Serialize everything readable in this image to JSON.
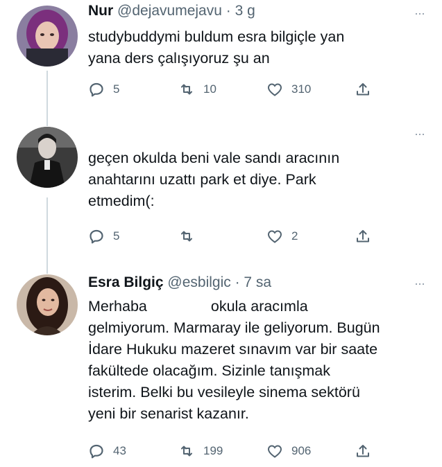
{
  "tweets": [
    {
      "name": "Nur",
      "meta": "@dejavumejavu · 3 g",
      "text_lines": [
        "studybuddymi buldum esra bilgiçle yan",
        "yana ders çalışıyoruz şu an"
      ],
      "reply_count": "5",
      "retweet_count": "10",
      "like_count": "310",
      "more": "···"
    },
    {
      "name": "",
      "meta": "",
      "text_lines": [
        "geçen okulda beni vale sandı aracının",
        "anahtarını uzattı park et diye. Park",
        "etmedim(:"
      ],
      "reply_count": "5",
      "retweet_count": "",
      "like_count": "2",
      "more": "···"
    },
    {
      "name": "Esra Bilgiç",
      "meta": "@esbilgic · 7 sa",
      "text_first_a": "Merhaba",
      "text_first_b": "okula aracımla",
      "text_lines": [
        "gelmiyorum. Marmaray ile geliyorum. Bugün",
        "İdare Hukuku mazeret sınavım var bir saate",
        "fakültede olacağım. Sizinle tanışmak",
        "isterim. Belki bu vesileyle sinema sektörü",
        "yeni bir senarist kazanır."
      ],
      "reply_count": "43",
      "retweet_count": "199",
      "like_count": "906",
      "more": "···"
    }
  ],
  "icons": {
    "reply": "reply-icon",
    "retweet": "retweet-icon",
    "like": "like-icon",
    "share": "share-icon"
  },
  "colors": {
    "text": "#0f1419",
    "secondary": "#536471",
    "thread_line": "#cfd9de"
  }
}
